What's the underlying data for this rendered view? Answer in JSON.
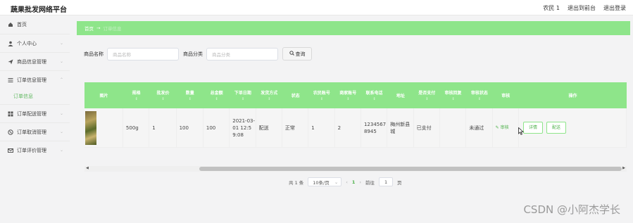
{
  "app": {
    "title": "蔬果批发网络平台"
  },
  "header": {
    "links": [
      "农民 1",
      "退出到前台",
      "退出登录"
    ]
  },
  "sidebar": {
    "items": [
      {
        "label": "首页",
        "icon": "home-icon",
        "chev": ""
      },
      {
        "label": "个人中心",
        "icon": "user-icon",
        "chev": "⌄"
      },
      {
        "label": "商品信息管理",
        "icon": "send-icon",
        "chev": "⌄"
      },
      {
        "label": "订单信息管理",
        "icon": "list-icon",
        "chev": "⌃"
      },
      {
        "label": "订单配送管理",
        "icon": "grid-icon",
        "chev": "⌄"
      },
      {
        "label": "订单取消管理",
        "icon": "cancel-icon",
        "chev": "⌄"
      },
      {
        "label": "订单评价管理",
        "icon": "mail-icon",
        "chev": "⌄"
      }
    ],
    "active_sub": "订单信息"
  },
  "breadcrumb": {
    "home": "首页",
    "arrow": "→",
    "current": "订单信息"
  },
  "search": {
    "name_label": "商品名称",
    "name_placeholder": "商品名称",
    "category_label": "商品分类",
    "category_placeholder": "商品分类",
    "button": "查询"
  },
  "table": {
    "headers": [
      "图片",
      "规格",
      "批发价",
      "数量",
      "总金额",
      "下单日期",
      "发货方式",
      "状态",
      "农民账号",
      "商家账号",
      "联系电话",
      "地址",
      "是否支付",
      "审核回复",
      "审核状态",
      "审核",
      "操作"
    ],
    "sort_marker": "↕",
    "row": {
      "spec": "500g",
      "price": "1",
      "qty": "100",
      "total": "100",
      "date": "2021-03-01 12:59:08",
      "ship": "配送",
      "status": "正常",
      "farmer": "1",
      "merchant": "2",
      "phone": "12345678945",
      "address": "梅州新县城",
      "paid": "已支付",
      "reply": "",
      "audit_status": "未通过",
      "audit_link": "审核",
      "detail_btn": "详情",
      "deliver_btn": "配送"
    }
  },
  "pager": {
    "total": "共 1 条",
    "page_size": "10条/页",
    "prev": "‹",
    "page": "1",
    "next": "›",
    "goto": "前往",
    "goto_value": "1",
    "page_unit": "页"
  },
  "watermark": "CSDN @小阿杰学长",
  "colors": {
    "accent": "#8ee58a",
    "link": "#4fb24c"
  }
}
